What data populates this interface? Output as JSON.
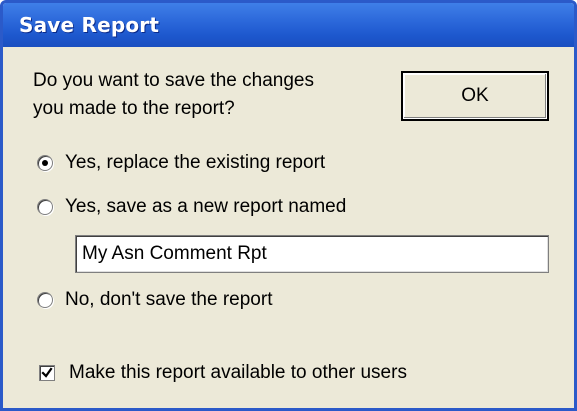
{
  "window": {
    "title": "Save Report"
  },
  "question": {
    "line1": "Do you want to save the changes",
    "line2": "you made to the report?"
  },
  "ok_button": {
    "label": "OK"
  },
  "options": [
    {
      "label": "Yes, replace the existing report",
      "selected": true
    },
    {
      "label": "Yes, save as a new report named",
      "selected": false
    },
    {
      "label": "No, don't save the report",
      "selected": false
    }
  ],
  "new_report_name": {
    "value": "My Asn Comment Rpt"
  },
  "share_checkbox": {
    "label": "Make this report available to other users",
    "checked": true
  },
  "colors": {
    "titlebar": "#2A66D9",
    "dialog_background": "#ECE9D8",
    "title_text": "#FFFFFF"
  }
}
